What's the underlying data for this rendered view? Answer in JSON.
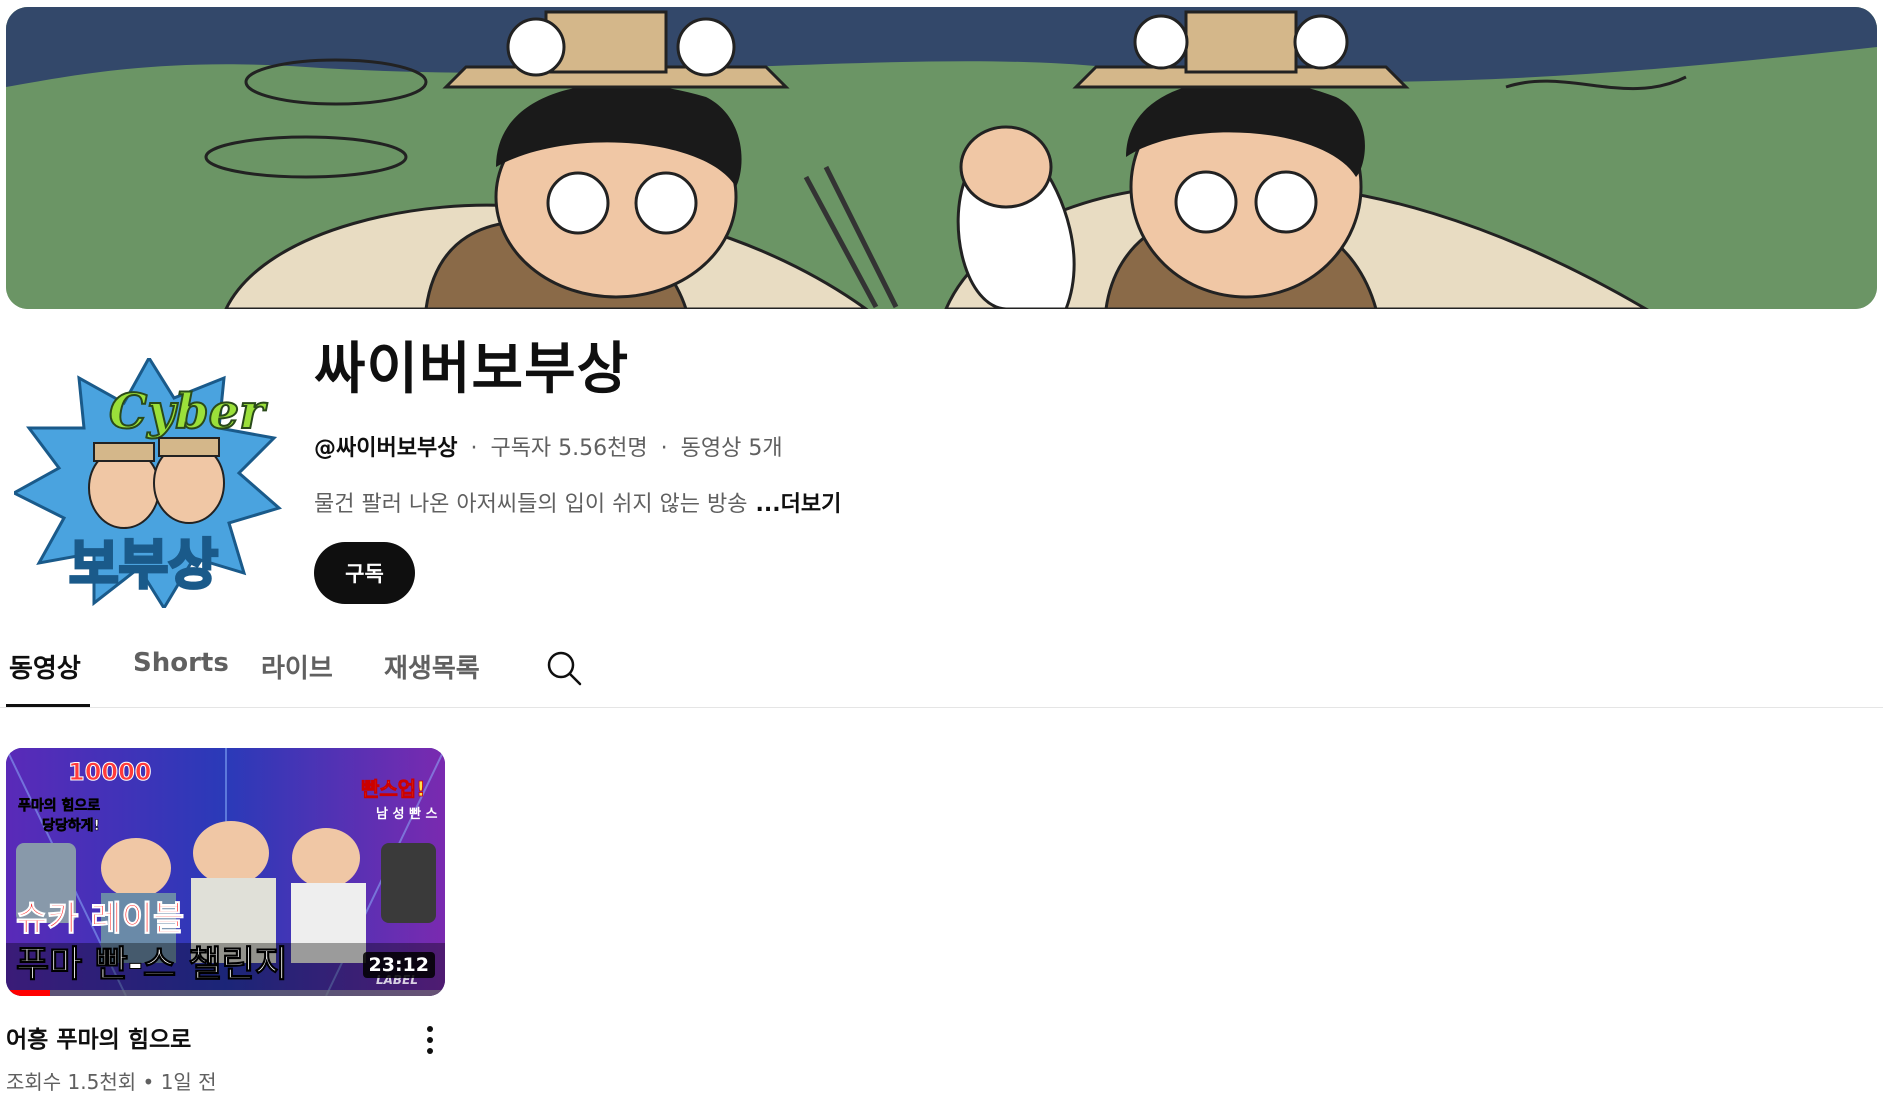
{
  "channel": {
    "title": "싸이버보부상",
    "handle": "@싸이버보부상",
    "separator": "·",
    "subscribers": "구독자 5.56천명",
    "video_count": "동영상 5개",
    "description": "물건 팔러 나온 아저씨들의 입이 쉬지 않는 방송",
    "more_label": "...더보기",
    "subscribe_label": "구독",
    "avatar_text_top": "Cyber",
    "avatar_text_bottom": "보부상"
  },
  "tabs": [
    {
      "label": "동영상",
      "active": true
    },
    {
      "label": "Shorts",
      "active": false
    },
    {
      "label": "라이브",
      "active": false
    },
    {
      "label": "재생목록",
      "active": false
    }
  ],
  "videos": [
    {
      "title": "어흥 푸마의 힘으로",
      "views": "조회수 1.5천회",
      "separator": "•",
      "age": "1일 전",
      "duration": "23:12",
      "progress": 0.1,
      "thumb_text_main": "푸마 빤-스 챌린지",
      "thumb_text_sub": "슈카 레이블",
      "thumb_badge": "빤스업!",
      "thumb_number": "10000",
      "thumb_caption_1": "푸마의 힘으로",
      "thumb_caption_2": "당당하게!",
      "thumb_sign": "남 성 빤 스",
      "thumb_logo": "LABEL"
    }
  ],
  "icons": {
    "search": "search-icon",
    "more": "more-vert-icon"
  },
  "colors": {
    "text": "#0f0f0f",
    "muted": "#606060",
    "subscribe_bg": "#0f0f0f",
    "progress": "#ff0000"
  }
}
